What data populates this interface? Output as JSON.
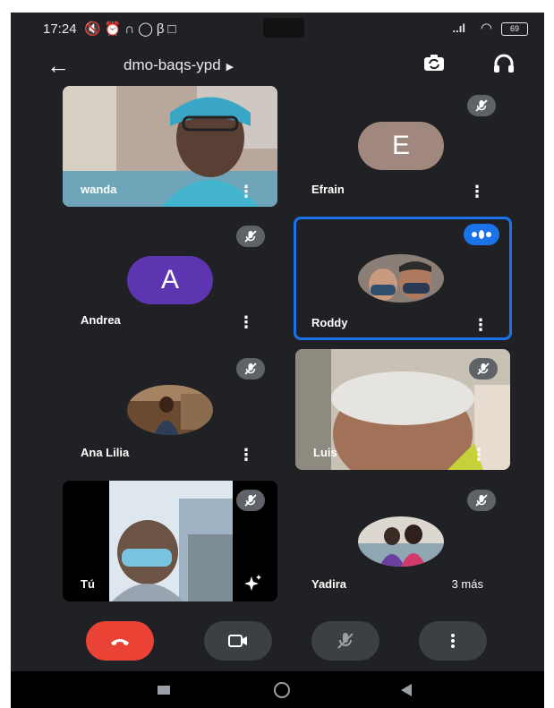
{
  "status_bar": {
    "time": "17:24",
    "battery": "69"
  },
  "top_bar": {
    "meeting_code": "dmo-baqs-ypd"
  },
  "participants": [
    {
      "name": "wanda"
    },
    {
      "name": "Efrain",
      "initial": "E"
    },
    {
      "name": "Andrea",
      "initial": "A"
    },
    {
      "name": "Roddy"
    },
    {
      "name": "Ana Lilia"
    },
    {
      "name": "Luis"
    },
    {
      "name": "Tú"
    },
    {
      "name": "Yadira"
    }
  ],
  "overflow": {
    "label": "3 más"
  },
  "colors": {
    "background": "#202124",
    "tile": "#3c4043",
    "accent": "#1a73e8",
    "end_call": "#ea4335",
    "avatar_e": "#a1887f",
    "avatar_a": "#5e35b1"
  },
  "icons": [
    "back-arrow-icon",
    "switch-camera-icon",
    "headphones-icon",
    "mic-off-icon",
    "more-vert-icon",
    "end-call-icon",
    "camera-icon",
    "effects-icon"
  ]
}
